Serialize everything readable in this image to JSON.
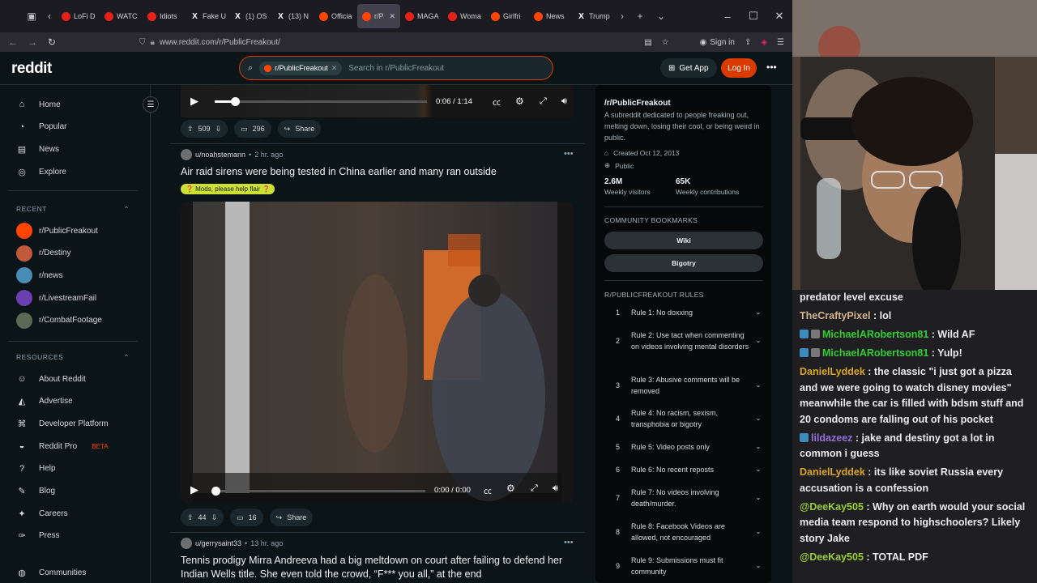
{
  "browser": {
    "tabs": [
      {
        "label": "LoFi D",
        "favicon": "youtube-icon"
      },
      {
        "label": "WATC",
        "favicon": "youtube-icon"
      },
      {
        "label": "Idiots",
        "favicon": "youtube-icon"
      },
      {
        "label": "Fake U",
        "favicon": "x-icon"
      },
      {
        "label": "(1) OS",
        "favicon": "x-icon"
      },
      {
        "label": "(13) N",
        "favicon": "x-icon"
      },
      {
        "label": "Officia",
        "favicon": "reddit-icon"
      },
      {
        "label": "r/P",
        "favicon": "reddit-icon",
        "active": true
      },
      {
        "label": "MAGA",
        "favicon": "youtube-icon"
      },
      {
        "label": "Woma",
        "favicon": "youtube-icon"
      },
      {
        "label": "Girlfri",
        "favicon": "reddit-icon"
      },
      {
        "label": "News",
        "favicon": "reddit-icon"
      },
      {
        "label": "Trump",
        "favicon": "x-icon"
      }
    ],
    "url": "www.reddit.com/r/PublicFreakout/",
    "signin": "Sign in"
  },
  "header": {
    "logo": "reddit",
    "search_chip": "r/PublicFreakout",
    "search_placeholder": "Search in r/PublicFreakout",
    "get_app": "Get App",
    "login": "Log In"
  },
  "leftnav": {
    "main": [
      {
        "label": "Home",
        "icon": "home-icon"
      },
      {
        "label": "Popular",
        "icon": "popular-icon"
      },
      {
        "label": "News",
        "icon": "news-icon"
      },
      {
        "label": "Explore",
        "icon": "explore-icon"
      }
    ],
    "recent_header": "RECENT",
    "recent": [
      {
        "label": "r/PublicFreakout",
        "color": "#ff4500"
      },
      {
        "label": "r/Destiny",
        "color": "#c05a3a"
      },
      {
        "label": "r/news",
        "color": "#4a8bb5"
      },
      {
        "label": "r/LivestreamFail",
        "color": "#6a3fb0"
      },
      {
        "label": "r/CombatFootage",
        "color": "#5b6a55"
      }
    ],
    "resources_header": "RESOURCES",
    "resources": [
      {
        "label": "About Reddit",
        "icon": "reddit-icon"
      },
      {
        "label": "Advertise",
        "icon": "advertise-icon"
      },
      {
        "label": "Developer Platform",
        "icon": "developer-icon"
      },
      {
        "label": "Reddit Pro",
        "icon": "pro-icon",
        "badge": "BETA"
      },
      {
        "label": "Help",
        "icon": "help-icon"
      },
      {
        "label": "Blog",
        "icon": "blog-icon"
      },
      {
        "label": "Careers",
        "icon": "careers-icon"
      },
      {
        "label": "Press",
        "icon": "press-icon"
      },
      {
        "label": "Communities",
        "icon": "communities-icon"
      }
    ]
  },
  "feed": {
    "top_player": {
      "time": "0:06 / 1:14",
      "progress": 0.08
    },
    "top_actions": {
      "votes": "509",
      "comments": "296",
      "share": "Share"
    },
    "post1": {
      "user": "u/noahstemann",
      "time": "2 hr. ago",
      "title": "Air raid sirens were being tested in China earlier and many ran outside",
      "flair": "❓ Mods, please help flair ❓",
      "video_time": "0:00 / 0:00",
      "votes": "44",
      "comments": "16",
      "share": "Share"
    },
    "post2": {
      "user": "u/gerrysaint33",
      "time": "13 hr. ago",
      "title": "Tennis prodigy Mirra Andreeva had a big meltdown on court after failing to defend her Indian Wells title. She even told the crowd, “F*** you all,” at the end"
    }
  },
  "sidebar": {
    "title": "/r/PublicFreakout",
    "description": "A subreddit dedicated to people freaking out, melting down, losing their cool, or being weird in public.",
    "created": "Created Oct 12, 2013",
    "visibility": "Public",
    "stats": [
      {
        "num": "2.6M",
        "label": "Weekly visitors"
      },
      {
        "num": "65K",
        "label": "Weekly contributions"
      }
    ],
    "bookmarks_header": "COMMUNITY BOOKMARKS",
    "bookmarks": [
      "Wiki",
      "Bigotry"
    ],
    "rules_header": "R/PUBLICFREAKOUT RULES",
    "rules": [
      {
        "n": "1",
        "text": "Rule 1: No doxxing"
      },
      {
        "n": "2",
        "text": "Rule 2: Use tact when commenting on videos involving mental disorders"
      },
      {
        "n": "3",
        "text": "Rule 3: Abusive comments will be removed"
      },
      {
        "n": "4",
        "text": "Rule 4: No racism, sexism, transphobia or bigotry"
      },
      {
        "n": "5",
        "text": "Rule 5: Video posts only"
      },
      {
        "n": "6",
        "text": "Rule 6: No recent reposts"
      },
      {
        "n": "7",
        "text": "Rule 7: No videos involving death/murder."
      },
      {
        "n": "8",
        "text": "Rule 8: Facebook Videos are allowed, not encouraged"
      },
      {
        "n": "9",
        "text": "Rule 9: Submissions must fit community"
      }
    ]
  },
  "stream": {
    "chat": [
      {
        "user": "",
        "text": "predator level excuse",
        "color": "#ececec"
      },
      {
        "user": "TheCraftyPixel",
        "text": ": lol",
        "color": "#d2b48c"
      },
      {
        "user": "MichaelARobertson81",
        "text": ": Wild AF",
        "color": "#32cd32",
        "badges": true
      },
      {
        "user": "MichaelARobertson81",
        "text": ": Yulp!",
        "color": "#32cd32",
        "badges": true
      },
      {
        "user": "DanielLyddek",
        "text": ": the classic \"i just got a pizza and we were going to watch disney movies\" meanwhile the car is filled with bdsm stuff and 20 condoms are falling out of his pocket",
        "color": "#daa520"
      },
      {
        "user": "lildazeez",
        "text": ": jake and destiny got a lot in common i guess",
        "color": "#9370db",
        "badge_one": true
      },
      {
        "user": "DanielLyddek",
        "text": ": its like soviet Russia every accusation is a confession",
        "color": "#daa520"
      },
      {
        "user": "@DeeKay505",
        "text": ": Why on earth would your social media team respond to highschoolers? Likely story Jake",
        "color": "#9acd32"
      },
      {
        "user": "@DeeKay505",
        "text": ": TOTAL PDF",
        "color": "#9acd32"
      }
    ]
  }
}
